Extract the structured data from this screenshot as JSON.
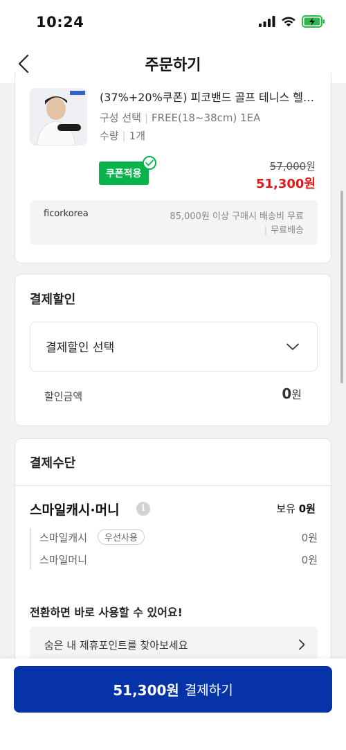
{
  "status": {
    "time": "10:24"
  },
  "header": {
    "title": "주문하기"
  },
  "product": {
    "name": "(37%+20%쿠폰) 피코밴드 골프 테니스 헬…",
    "option_label": "구성 선택",
    "option_value": "FREE(18~38cm) 1EA",
    "qty_label": "수량",
    "qty_value": "1개",
    "coupon_badge": "쿠폰적용",
    "original_price": "57,000",
    "sale_price": "51,300",
    "currency": "원",
    "seller": "ficorkorea",
    "shipping_condition": "85,000원 이상 구매시 배송비 무료",
    "shipping_type": "무료배송"
  },
  "discount": {
    "title": "결제할인",
    "select_label": "결제할인 선택",
    "amount_label": "할인금액",
    "amount_value": "0",
    "amount_unit": "원"
  },
  "payment": {
    "title": "결제수단",
    "smile_title": "스마일캐시·머니",
    "info_icon": "i",
    "hold_label": "보유",
    "hold_value": "0원",
    "items": [
      {
        "label": "스마일캐시",
        "badge": "우선사용",
        "value": "0원"
      },
      {
        "label": "스마일머니",
        "value": "0원"
      }
    ],
    "switch_text": "전환하면 바로 사용할 수 있어요!",
    "points_link": "숨은 내 제휴포인트를 찾아보세요"
  },
  "checkout": {
    "amount": "51,300원",
    "label": "결제하기"
  },
  "colors": {
    "primary_button": "#0733a8",
    "coupon_green": "#09b24b",
    "sale_red": "#e0191b"
  }
}
